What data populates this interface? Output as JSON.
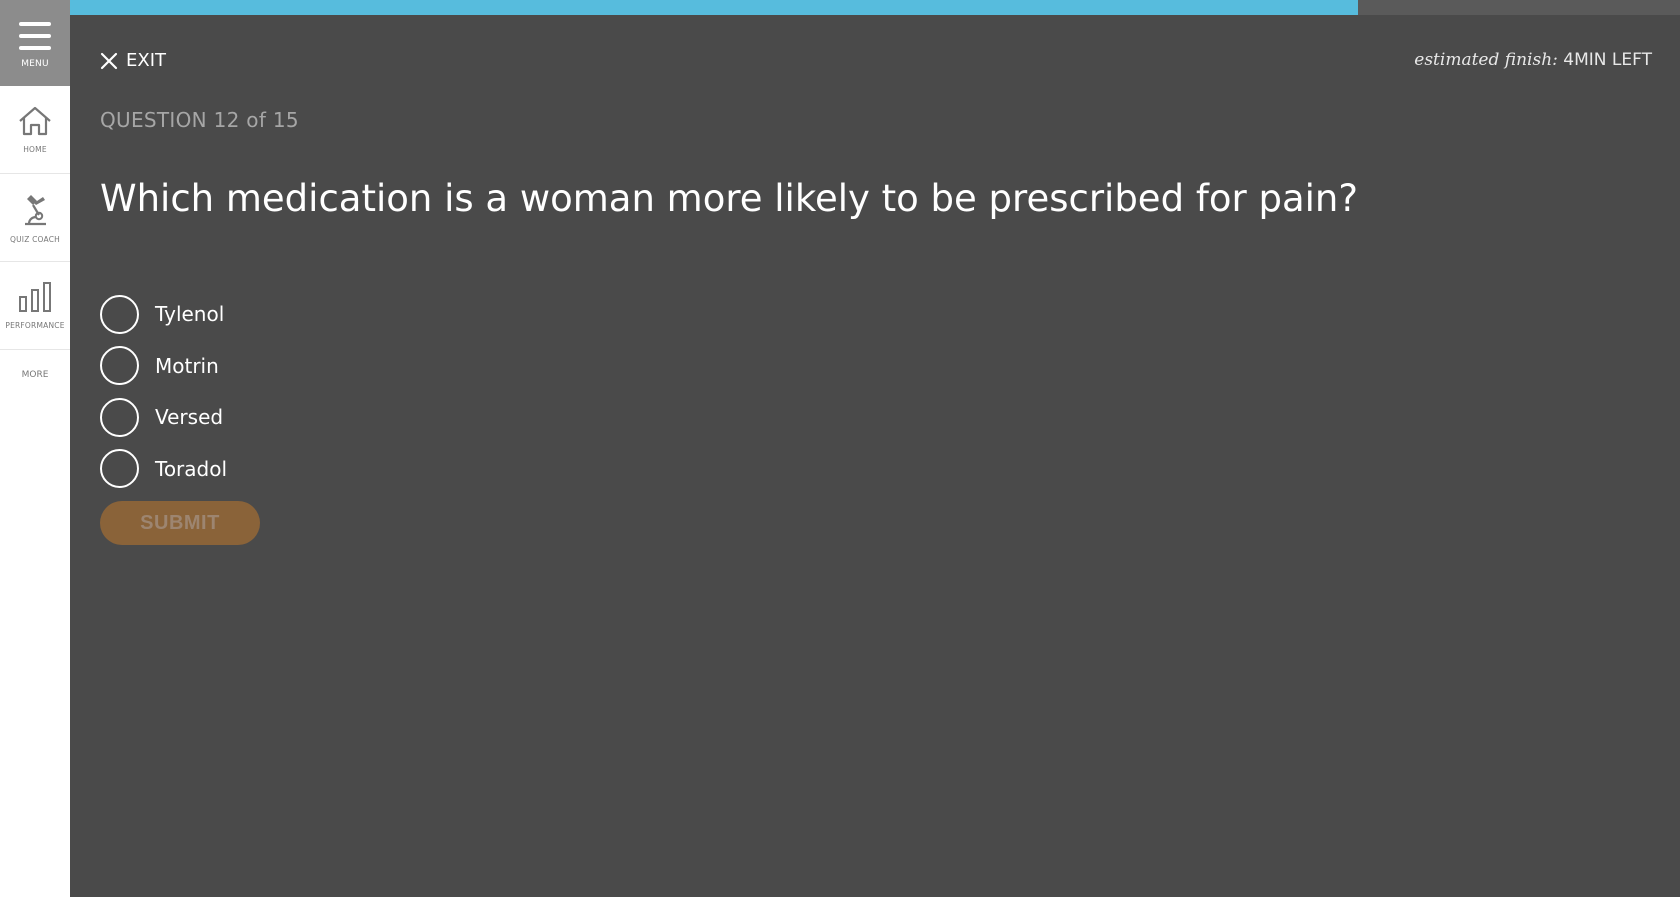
{
  "sidebar": {
    "menu_label": "MENU",
    "items": [
      {
        "label": "HOME",
        "icon": "home-icon"
      },
      {
        "label": "QUIZ COACH",
        "icon": "quiz-coach-icon"
      },
      {
        "label": "PERFORMANCE",
        "icon": "bar-chart-icon"
      }
    ],
    "more_label": "MORE"
  },
  "progress": {
    "fraction": 0.8,
    "fill_color": "#57bcdd"
  },
  "header": {
    "exit_label": "EXIT",
    "estimate_italic": "estimated finish:",
    "estimate_value": "4MIN LEFT"
  },
  "quiz": {
    "counter": "QUESTION 12 of 15",
    "question": "Which medication is a woman more likely to be prescribed for pain?",
    "options": [
      "Tylenol",
      "Motrin",
      "Versed",
      "Toradol"
    ],
    "submit_label": "SUBMIT"
  },
  "colors": {
    "background": "#4a4a4a",
    "sidebar": "#ffffff",
    "menu_button": "#8c8c8c",
    "submit_button": "#8a6339"
  }
}
